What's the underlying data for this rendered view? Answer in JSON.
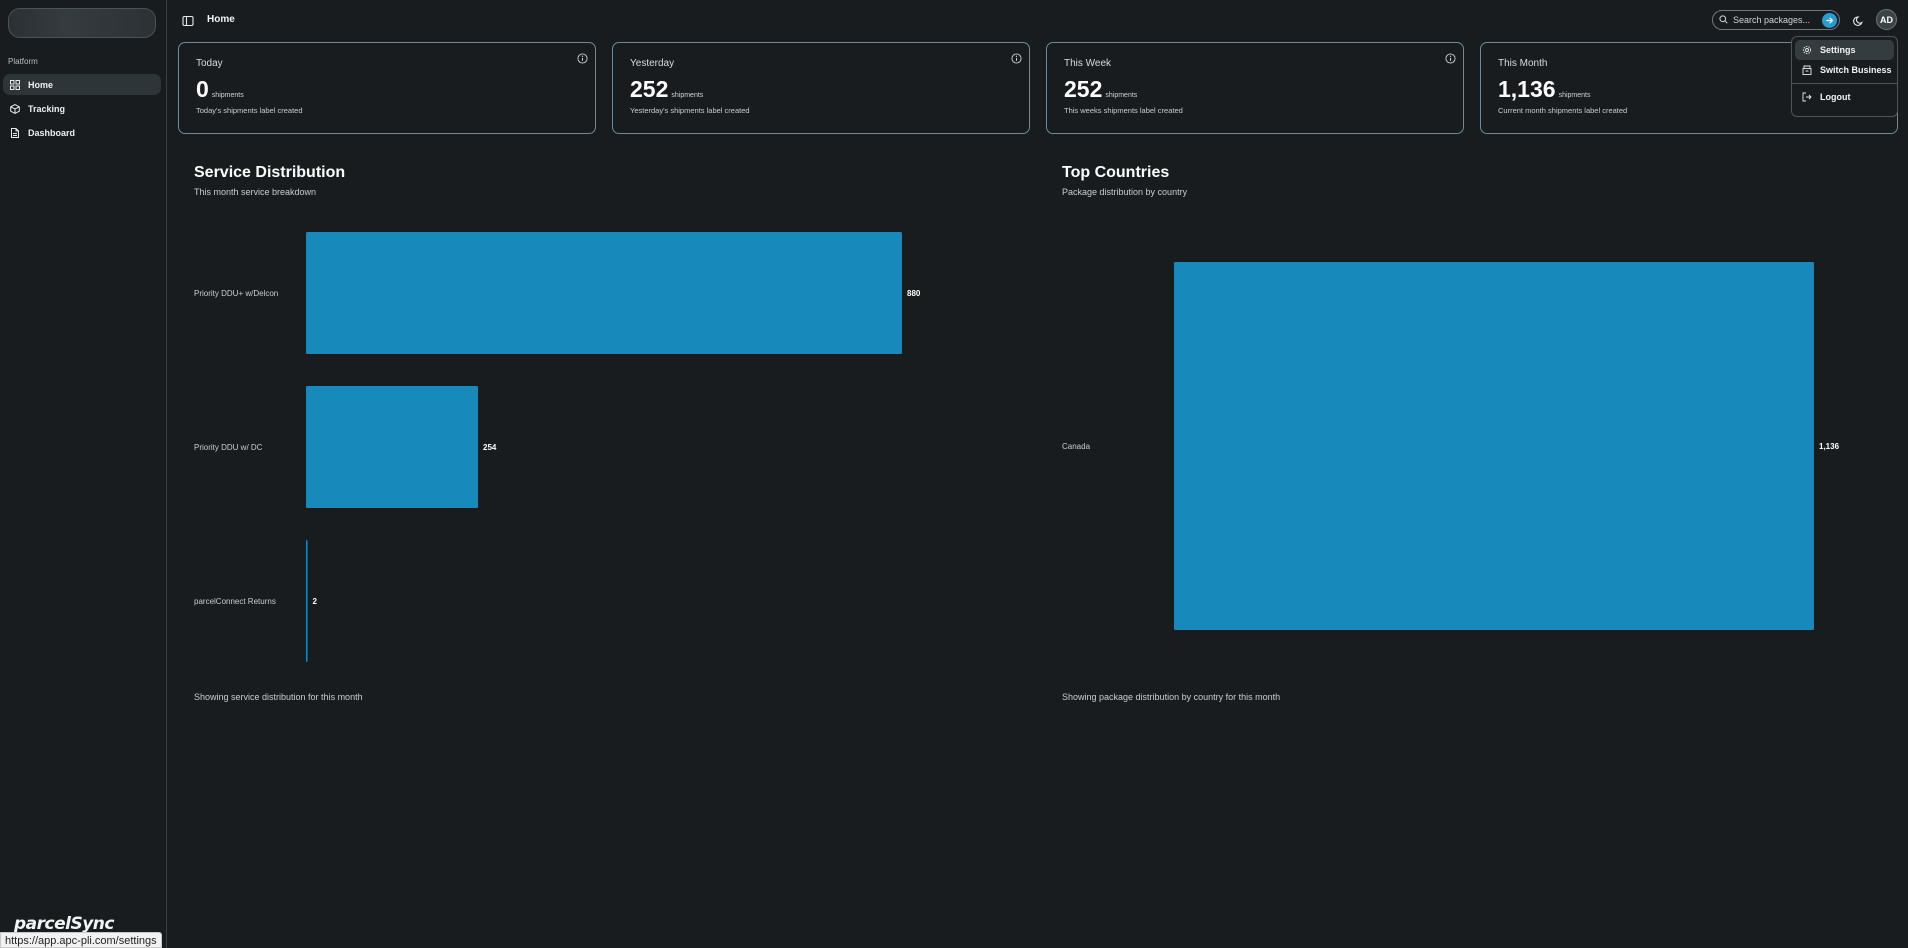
{
  "sidebar": {
    "section_label": "Platform",
    "items": [
      {
        "label": "Home",
        "icon": "grid-icon",
        "active": true
      },
      {
        "label": "Tracking",
        "icon": "package-icon",
        "active": false
      },
      {
        "label": "Dashboard",
        "icon": "file-icon",
        "active": false
      }
    ],
    "logo_text": "parcelSync"
  },
  "status_url": "https://app.apc-pli.com/settings",
  "header": {
    "title": "Home",
    "search_placeholder": "Search packages...",
    "avatar_initials": "AD"
  },
  "stats": [
    {
      "label": "Today",
      "value": "0",
      "unit": "shipments",
      "desc": "Today's shipments label created"
    },
    {
      "label": "Yesterday",
      "value": "252",
      "unit": "shipments",
      "desc": "Yesterday's shipments label created"
    },
    {
      "label": "This Week",
      "value": "252",
      "unit": "shipments",
      "desc": "This weeks shipments label created"
    },
    {
      "label": "This Month",
      "value": "1,136",
      "unit": "shipments",
      "desc": "Current month shipments label created"
    }
  ],
  "dropdown": {
    "items": [
      {
        "label": "Settings",
        "icon": "gear-icon"
      },
      {
        "label": "Switch Business",
        "icon": "building-icon"
      },
      {
        "label": "Logout",
        "icon": "logout-icon"
      }
    ]
  },
  "colors": {
    "bar": "#178abb",
    "background": "#181c1f",
    "accent": "#2a9bd3"
  },
  "chart_data": [
    {
      "type": "bar",
      "orientation": "horizontal",
      "title": "Service Distribution",
      "subtitle": "This month service breakdown",
      "footer": "Showing service distribution for this month",
      "categories": [
        "Priority DDU+ w/Delcon",
        "Priority DDU w/ DC",
        "parcelConnect Returns"
      ],
      "values": [
        880,
        254,
        2
      ],
      "value_labels": [
        "880",
        "254",
        "2"
      ],
      "grid": false
    },
    {
      "type": "bar",
      "orientation": "horizontal",
      "title": "Top Countries",
      "subtitle": "Package distribution by country",
      "footer": "Showing package distribution by country for this month",
      "categories": [
        "Canada"
      ],
      "values": [
        1136
      ],
      "value_labels": [
        "1,136"
      ],
      "grid": false
    }
  ]
}
